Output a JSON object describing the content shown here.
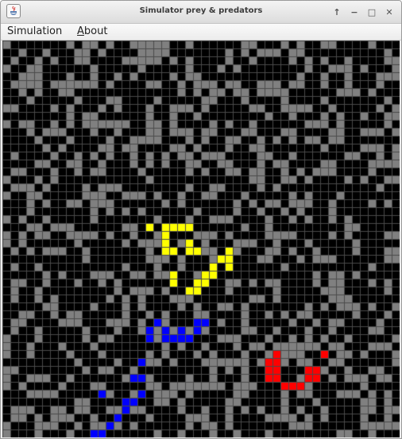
{
  "window": {
    "title": "Simulator prey & predators",
    "buttons": [
      "↑",
      "−",
      "□",
      "✕"
    ]
  },
  "menubar": {
    "items": [
      {
        "label": "Simulation",
        "mnemonic": ""
      },
      {
        "label": "bout",
        "mnemonic": "A"
      }
    ]
  },
  "simulation": {
    "columns": 50,
    "rows": 50,
    "colors": {
      "empty": "#000000",
      "grass": "#808080",
      "grid_line": "#4a4a4a",
      "yellow_agent": "#ffff00",
      "blue_agent": "#0000ff",
      "red_agent": "#ff0000"
    },
    "yellow_cells": [
      [
        18,
        23
      ],
      [
        20,
        23
      ],
      [
        21,
        23
      ],
      [
        22,
        23
      ],
      [
        23,
        23
      ],
      [
        20,
        24
      ],
      [
        20,
        25
      ],
      [
        23,
        25
      ],
      [
        20,
        26
      ],
      [
        21,
        26
      ],
      [
        23,
        26
      ],
      [
        24,
        26
      ],
      [
        28,
        26
      ],
      [
        27,
        27
      ],
      [
        28,
        27
      ],
      [
        26,
        28
      ],
      [
        28,
        28
      ],
      [
        21,
        29
      ],
      [
        25,
        29
      ],
      [
        26,
        29
      ],
      [
        21,
        30
      ],
      [
        24,
        30
      ],
      [
        25,
        30
      ],
      [
        23,
        31
      ],
      [
        24,
        31
      ]
    ],
    "blue_cells": [
      [
        19,
        35
      ],
      [
        24,
        35
      ],
      [
        25,
        35
      ],
      [
        18,
        36
      ],
      [
        20,
        36
      ],
      [
        22,
        36
      ],
      [
        24,
        36
      ],
      [
        18,
        37
      ],
      [
        20,
        37
      ],
      [
        21,
        37
      ],
      [
        22,
        37
      ],
      [
        23,
        37
      ],
      [
        17,
        40
      ],
      [
        16,
        42
      ],
      [
        17,
        42
      ],
      [
        12,
        44
      ],
      [
        17,
        44
      ],
      [
        15,
        45
      ],
      [
        16,
        45
      ],
      [
        15,
        46
      ],
      [
        14,
        47
      ],
      [
        13,
        48
      ],
      [
        12,
        49
      ],
      [
        11,
        49
      ]
    ],
    "red_cells": [
      [
        34,
        39
      ],
      [
        40,
        39
      ],
      [
        33,
        40
      ],
      [
        34,
        40
      ],
      [
        33,
        41
      ],
      [
        34,
        41
      ],
      [
        38,
        41
      ],
      [
        39,
        41
      ],
      [
        33,
        42
      ],
      [
        34,
        42
      ],
      [
        38,
        42
      ],
      [
        39,
        42
      ],
      [
        35,
        43
      ],
      [
        36,
        43
      ],
      [
        37,
        43
      ]
    ]
  }
}
